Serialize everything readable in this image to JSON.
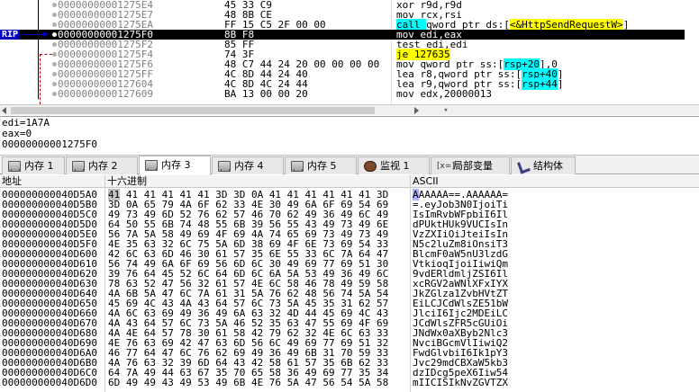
{
  "disasm": {
    "rip_label": "RIP",
    "rows": [
      {
        "addr": "00000000001275E4",
        "bytes": "45 33 C9",
        "instr": "xor r9d,r9d"
      },
      {
        "addr": "00000000001275E7",
        "bytes": "48 8B CE",
        "instr": "mov rcx,rsi"
      },
      {
        "addr": "00000000001275EA",
        "bytes": "FF 15 C5 2F 00 00",
        "instr_pre": "call ",
        "instr_mid": "qword ptr ds:[",
        "instr_label": "<&HttpSendRequestW>",
        "instr_post": "]"
      },
      {
        "addr": "00000000001275F0",
        "bytes": "8B F8",
        "instr": "mov edi,eax",
        "rip": true
      },
      {
        "addr": "00000000001275F2",
        "bytes": "85 FF",
        "instr": "test edi,edi"
      },
      {
        "addr": "00000000001275F4",
        "bytes": "74 3F",
        "instr_jmp": "je 127635"
      },
      {
        "addr": "00000000001275F6",
        "bytes": "48 C7 44 24 20 00 00 00 00",
        "instr_pre": "mov qword ptr ss:[",
        "instr_ref": "rsp+20",
        "instr_post": "],0"
      },
      {
        "addr": "00000000001275FF",
        "bytes": "4C 8D 44 24 40",
        "instr_pre": "lea r8,qword ptr ss:[",
        "instr_ref": "rsp+40",
        "instr_post": "]"
      },
      {
        "addr": "0000000000127604",
        "bytes": "4C 8D 4C 24 44",
        "instr_pre": "lea r9,qword ptr ss:[",
        "instr_ref": "rsp+44",
        "instr_post": "]"
      },
      {
        "addr": "0000000000127609",
        "bytes": "BA 13 00 00 20",
        "instr": "mov edx,20000013"
      }
    ]
  },
  "info": {
    "line1": "edi=1A7A",
    "line2": "eax=0",
    "line3": "00000000001275F0"
  },
  "tabs": [
    {
      "label": "内存 1",
      "icon": "memory-chip-icon"
    },
    {
      "label": "内存 2",
      "icon": "memory-chip-icon"
    },
    {
      "label": "内存 3",
      "icon": "memory-chip-icon",
      "active": true
    },
    {
      "label": "内存 4",
      "icon": "memory-chip-icon"
    },
    {
      "label": "内存 5",
      "icon": "memory-chip-icon"
    },
    {
      "label": "监视 1",
      "icon": "watch-icon"
    },
    {
      "label": "局部变量",
      "icon": "locals-icon",
      "icon_text": "[x=]"
    },
    {
      "label": "结构体",
      "icon": "struct-icon"
    }
  ],
  "dump": {
    "headers": {
      "addr": "地址",
      "hex": "十六进制",
      "ascii": "ASCII"
    },
    "rows": [
      {
        "addr": "000000000040D5A0",
        "hex": "41 41 41 41 41 41 3D 3D 0A 41 41 41 41 41 41 3D",
        "ascii": "AAAAAA==.AAAAAA="
      },
      {
        "addr": "000000000040D5B0",
        "hex": "3D 0A 65 79 4A 6F 62 33 4E 30 49 6A 6F 69 54 69",
        "ascii": "=.eyJob3N0IjoiTi"
      },
      {
        "addr": "000000000040D5C0",
        "hex": "49 73 49 6D 52 76 62 57 46 70 62 49 36 49 6C 49",
        "ascii": "IsImRvbWFpbiI6Il"
      },
      {
        "addr": "000000000040D5D0",
        "hex": "64 50 55 6B 74 48 55 6B 39 56 55 43 49 73 49 6E",
        "ascii": "dPUktHUk9VUCIsIn"
      },
      {
        "addr": "000000000040D5E0",
        "hex": "56 7A 5A 58 49 69 4F 69 4A 74 65 69 73 49 73 49",
        "ascii": "VzZXIiOiJteiIsIn"
      },
      {
        "addr": "000000000040D5F0",
        "hex": "4E 35 63 32 6C 75 5A 6D 38 69 4F 6E 73 69 54 33",
        "ascii": "N5c2luZm8iOnsiT3"
      },
      {
        "addr": "000000000040D600",
        "hex": "42 6C 63 6D 46 30 61 57 35 6E 55 33 6C 7A 64 47",
        "ascii": "BlcmF0aW5nU3lzdG"
      },
      {
        "addr": "000000000040D610",
        "hex": "56 74 49 6A 6F 69 56 6D 6C 30 49 69 77 69 51 30",
        "ascii": "VtkioqIjoiIiwiQm"
      },
      {
        "addr": "000000000040D620",
        "hex": "39 76 64 45 52 6C 64 6D 6C 6A 5A 53 49 36 49 6C",
        "ascii": "9vdERldmljZSI6Il"
      },
      {
        "addr": "000000000040D630",
        "hex": "78 63 52 47 56 32 61 57 4E 6C 58 46 78 49 59 58",
        "ascii": "xcRGV2aWNlXFxIYX"
      },
      {
        "addr": "000000000040D640",
        "hex": "4A 6B 5A 47 6C 7A 61 31 5A 76 62 48 56 74 5A 54",
        "ascii": "JkZGlza1ZvbHVtZT"
      },
      {
        "addr": "000000000040D650",
        "hex": "45 69 4C 43 4A 43 64 57 6C 73 5A 45 35 31 62 57",
        "ascii": "EiLCJCdWlsZE51bW"
      },
      {
        "addr": "000000000040D660",
        "hex": "4A 6C 63 69 49 36 49 6A 63 32 4D 44 45 69 4C 43",
        "ascii": "JlciI6Ijc2MDEiLC"
      },
      {
        "addr": "000000000040D670",
        "hex": "4A 43 64 57 6C 73 5A 46 52 35 63 47 55 69 4F 69",
        "ascii": "JCdWlsZFR5cGUiOi"
      },
      {
        "addr": "000000000040D680",
        "hex": "4A 4E 64 57 78 30 61 58 42 79 62 32 4E 6C 63 33",
        "ascii": "JNdWx0aXByb2Nlc3"
      },
      {
        "addr": "000000000040D690",
        "hex": "4E 76 63 69 42 47 63 6D 56 6C 49 69 77 69 51 32",
        "ascii": "NvciBGcmVlIiwiQ2"
      },
      {
        "addr": "000000000040D6A0",
        "hex": "46 77 64 47 6C 76 62 69 49 36 49 6B 31 70 59 33",
        "ascii": "FwdGlvbiI6Ik1pY3"
      },
      {
        "addr": "000000000040D6B0",
        "hex": "4A 76 63 32 39 6D 64 43 42 58 61 57 35 6B 62 33",
        "ascii": "Jvc29mdCBXaW5kb3"
      },
      {
        "addr": "000000000040D6C0",
        "hex": "64 7A 49 44 63 67 35 70 65 58 36 49 69 77 35 34",
        "ascii": "dzIDcg5peX6Iiw54"
      },
      {
        "addr": "000000000040D6D0",
        "hex": "6D 49 49 43 49 53 49 6B 4E 76 5A 47 56 54 5A 58",
        "ascii": "mIICISIkNvZGVTZX"
      }
    ]
  },
  "colors": {
    "rip_bg": "#000000",
    "call_highlight": "#00ffff",
    "jump_highlight": "#ffff00",
    "rip_tag": "#0000c0"
  }
}
